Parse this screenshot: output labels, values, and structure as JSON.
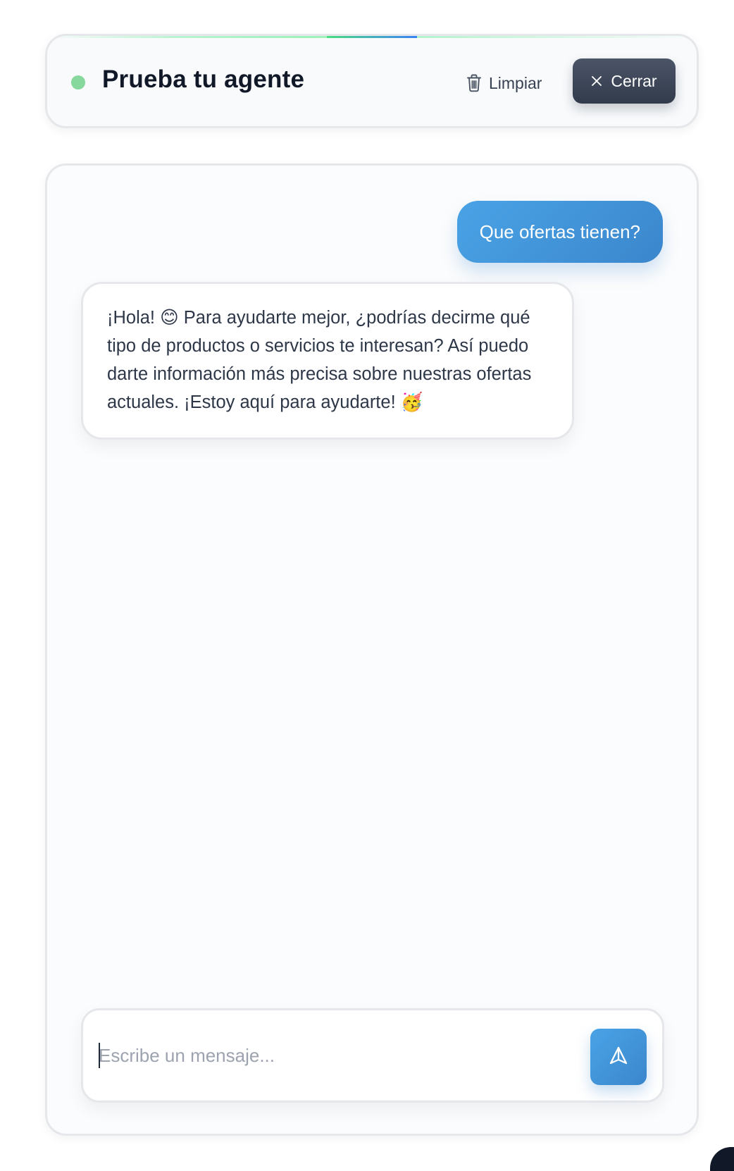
{
  "header": {
    "title": "Prueba tu agente",
    "status": "online",
    "clear_label": "Limpiar",
    "close_label": "Cerrar",
    "accent_color": "#3b86cc",
    "status_color": "#86d89c"
  },
  "chat": {
    "messages": [
      {
        "role": "user",
        "text": "Que ofertas tienen?"
      },
      {
        "role": "assistant",
        "text": "¡Hola! 😊 Para ayudarte mejor, ¿podrías decirme qué tipo de productos o servicios te interesan? Así puedo darte información más precisa sobre nuestras ofertas actuales. ¡Estoy aquí para ayudarte! 🥳"
      }
    ]
  },
  "composer": {
    "placeholder": "Escribe un mensaje...",
    "value": "",
    "send_icon": "send-icon"
  },
  "icons": {
    "clear": "trash-icon",
    "close": "close-icon",
    "send": "send-icon"
  }
}
